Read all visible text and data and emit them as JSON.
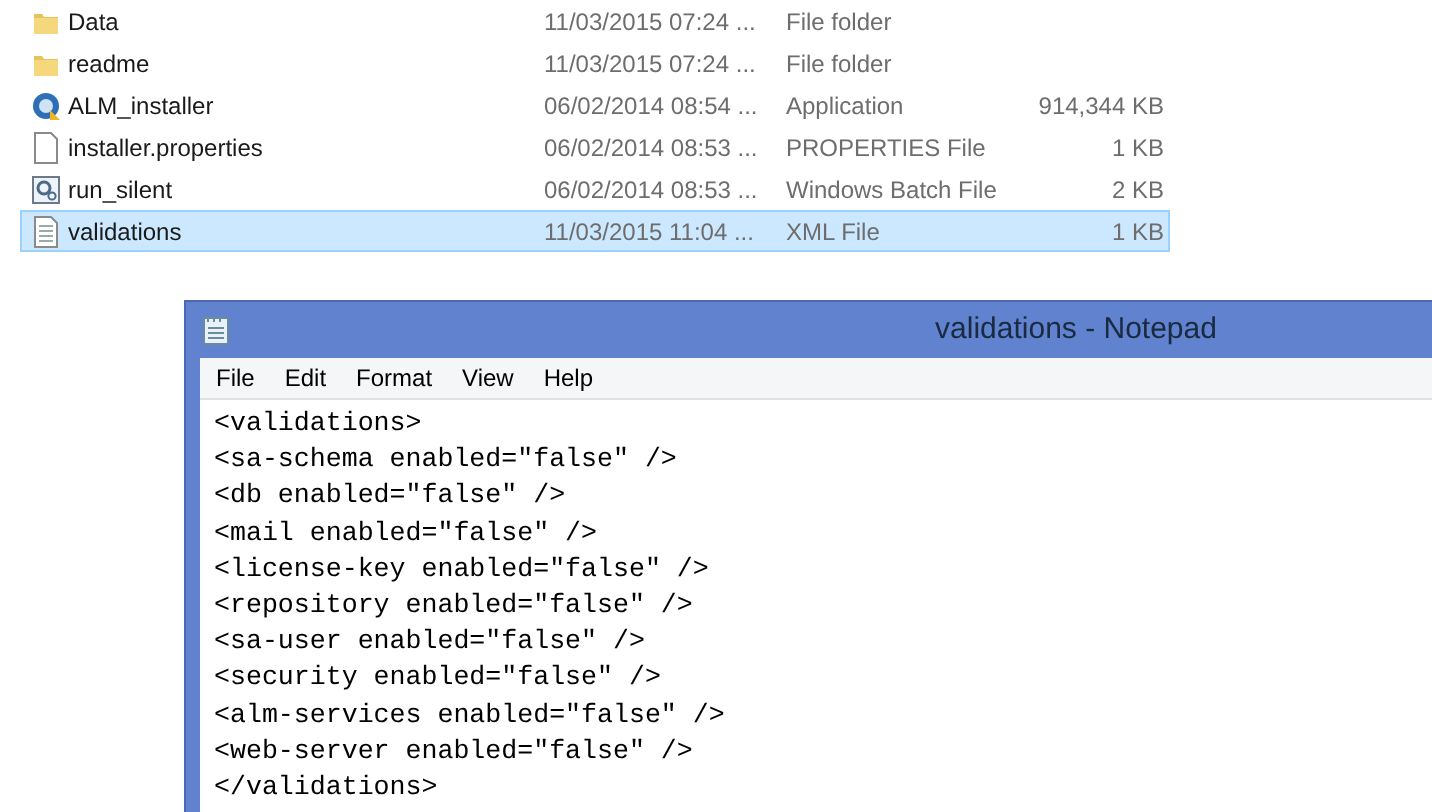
{
  "files": [
    {
      "kind": "folder",
      "name": "Data",
      "date": "11/03/2015 07:24 ...",
      "type": "File folder",
      "selected": false
    },
    {
      "kind": "folder",
      "name": "readme",
      "date": "11/03/2015 07:24 ...",
      "type": "File folder",
      "selected": false
    },
    {
      "kind": "app",
      "name": "ALM_installer",
      "date": "06/02/2014 08:54 ...",
      "type": "Application",
      "size": "914,344 KB",
      "selected": false
    },
    {
      "kind": "file",
      "name": "installer.properties",
      "date": "06/02/2014 08:53 ...",
      "type": "PROPERTIES File",
      "size": "1 KB",
      "selected": false
    },
    {
      "kind": "batch",
      "name": "run_silent",
      "date": "06/02/2014 08:53 ...",
      "type": "Windows Batch File",
      "size": "2 KB",
      "selected": false
    },
    {
      "kind": "text",
      "name": "validations",
      "date": "11/03/2015 11:04 ...",
      "type": "XML File",
      "size": "1 KB",
      "selected": true
    }
  ],
  "notepad": {
    "title": "validations - Notepad",
    "menu": [
      "File",
      "Edit",
      "Format",
      "View",
      "Help"
    ],
    "lines": [
      "<validations>",
      "<sa-schema enabled=\"false\" />",
      "<db enabled=\"false\" />",
      "<mail enabled=\"false\" />",
      "<license-key enabled=\"false\" />",
      "<repository enabled=\"false\" />",
      "<sa-user enabled=\"false\" />",
      "<security enabled=\"false\" />",
      "<alm-services enabled=\"false\" />",
      "<web-server enabled=\"false\" />",
      "</validations>"
    ]
  }
}
